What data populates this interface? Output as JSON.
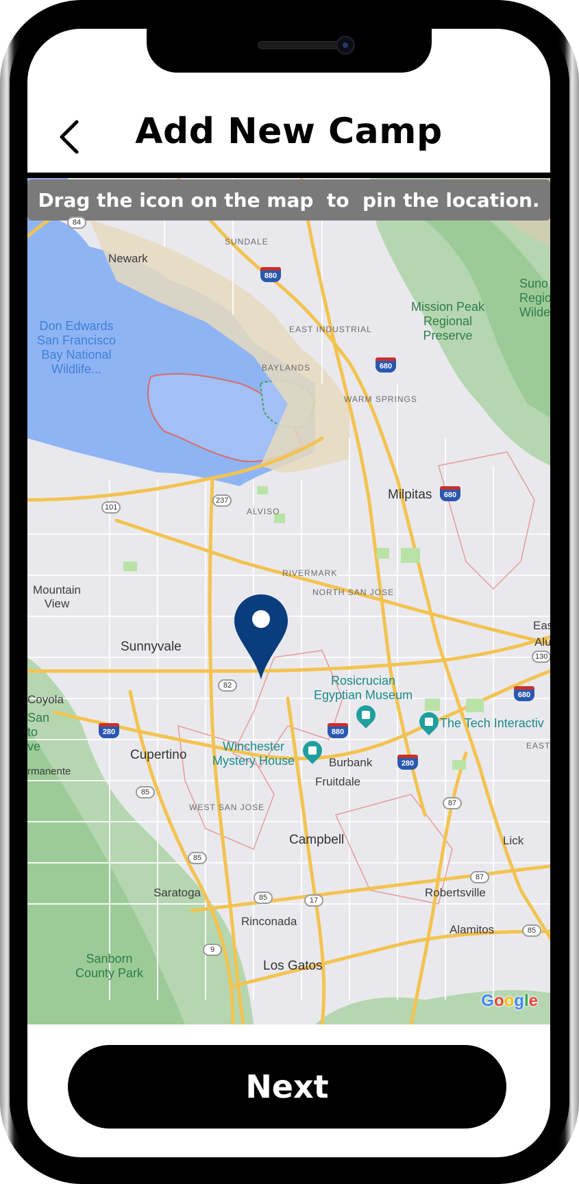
{
  "header": {
    "title": "Add New Camp",
    "back_icon": "chevron-left-icon"
  },
  "map": {
    "instruction": "Drag the icon on the map  to  pin the location.",
    "pin_icon": "location-pin-icon",
    "pin_color": "#0a3d7e",
    "attribution": [
      "G",
      "o",
      "o",
      "g",
      "l",
      "e"
    ],
    "labels": {
      "newark": "Newark",
      "sundale": "SUNDALE",
      "east_industrial": "EAST INDUSTRIAL",
      "baylands": "BAYLANDS",
      "warm_springs": "WARM SPRINGS",
      "mission_peak": "Mission Peak\nRegional\nPreserve",
      "sunol": "Suno\nRegio\nWilderr",
      "don_edwards": "Don Edwards\nSan Francisco\nBay National\nWildlife...",
      "milpitas": "Milpitas",
      "alviso": "ALVISO",
      "rivermark": "RIVERMARK",
      "north_san_jose": "NORTH SAN JOSE",
      "mountain_view": "Mountain\nView",
      "sunnyvale": "Sunnyvale",
      "rosicrucian": "Rosicrucian\nEgyptian Museum",
      "tech_interactive": "The Tech Interactiv",
      "winchester": "Winchester\nMystery House",
      "burbank": "Burbank",
      "fruitdale": "Fruitdale",
      "cupertino": "Cupertino",
      "coyola": "Coyola",
      "san_ve": "San\nto\nve",
      "permanente": "rmanente",
      "west_san_jose": "WEST SAN JOSE",
      "campbell": "Campbell",
      "saratoga": "Saratoga",
      "robertsville": "Robertsville",
      "rinconada": "Rinconada",
      "alamitos": "Alamitos",
      "los_gatos": "Los Gatos",
      "sanborn": "Sanborn\nCounty Park",
      "east": "East",
      "alum": "Alu",
      "east_small": "EAST",
      "lick": "Lick"
    },
    "shields": {
      "s84": "84",
      "s880a": "880",
      "s680a": "680",
      "s237": "237",
      "s101": "101",
      "s680b": "680",
      "s82": "82",
      "s880b": "880",
      "s280a": "280",
      "s280b": "280",
      "s680c": "680",
      "s85a": "85",
      "s87a": "87",
      "s85b": "85",
      "s85c": "85",
      "s17": "17",
      "s87b": "87",
      "s9": "9",
      "s85d": "85",
      "s130": "130"
    }
  },
  "footer": {
    "next_label": "Next"
  }
}
